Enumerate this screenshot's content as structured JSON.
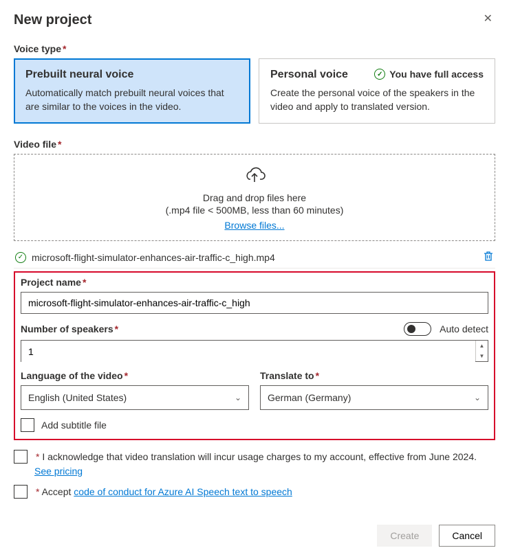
{
  "header": {
    "title": "New project"
  },
  "voice_type": {
    "label": "Voice type",
    "options": [
      {
        "title": "Prebuilt neural voice",
        "desc": "Automatically match prebuilt neural voices that are similar to the voices in the video.",
        "selected": true
      },
      {
        "title": "Personal voice",
        "desc": "Create the personal voice of the speakers in the video and apply to translated version.",
        "selected": false,
        "access": "You have full access"
      }
    ]
  },
  "video_file": {
    "label": "Video file",
    "drop_text": "Drag and drop files here",
    "constraint": "(.mp4 file < 500MB, less than 60 minutes)",
    "browse": "Browse files...",
    "uploaded": "microsoft-flight-simulator-enhances-air-traffic-c_high.mp4"
  },
  "project_name": {
    "label": "Project name",
    "value": "microsoft-flight-simulator-enhances-air-traffic-c_high"
  },
  "speakers": {
    "label": "Number of speakers",
    "auto_label": "Auto detect",
    "value": "1"
  },
  "language": {
    "label": "Language of the video",
    "value": "English (United States)"
  },
  "translate": {
    "label": "Translate to",
    "value": "German (Germany)"
  },
  "subtitle": {
    "label": "Add subtitle file"
  },
  "ack": {
    "prefix": "* ",
    "text": "I acknowledge that video translation will incur usage charges to my account, effective from June 2024. ",
    "link": "See pricing"
  },
  "coc": {
    "prefix": "* ",
    "text": "Accept ",
    "link": "code of conduct for Azure AI Speech text to speech"
  },
  "buttons": {
    "create": "Create",
    "cancel": "Cancel"
  }
}
